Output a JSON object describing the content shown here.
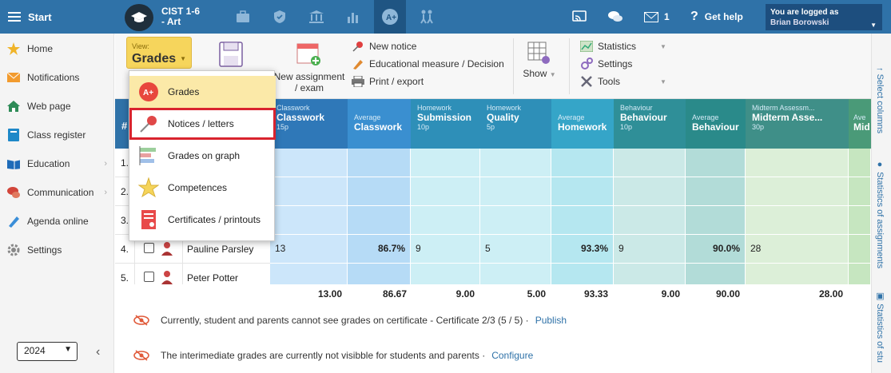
{
  "topbar": {
    "start_label": "Start",
    "class_name": "CIST 1-6",
    "class_sub": "- Art",
    "messages_count": "1",
    "help_label": "Get help",
    "login_caption": "You are logged as",
    "login_user": "Brian Borowski"
  },
  "sidebar": {
    "items": [
      {
        "label": "Home",
        "icon": "star-icon"
      },
      {
        "label": "Notifications",
        "icon": "envelope-icon"
      },
      {
        "label": "Web page",
        "icon": "house-icon"
      },
      {
        "label": "Class register",
        "icon": "book-icon"
      },
      {
        "label": "Education",
        "icon": "open-book-icon"
      },
      {
        "label": "Communication",
        "icon": "chat-icon"
      },
      {
        "label": "Agenda online",
        "icon": "pen-icon"
      },
      {
        "label": "Settings",
        "icon": "gear-icon"
      }
    ],
    "year": "2024"
  },
  "toolbar": {
    "view_caption": "View:",
    "view_value": "Grades",
    "new_assignment": "New assignment / exam",
    "new_notice": "New notice",
    "educational_measure": "Educational measure / Decision",
    "print_export": "Print / export",
    "show": "Show",
    "statistics": "Statistics",
    "settings": "Settings",
    "tools": "Tools"
  },
  "dropdown": {
    "items": [
      "Grades",
      "Notices / letters",
      "Grades on graph",
      "Competences",
      "Certificates / printouts"
    ]
  },
  "grid": {
    "num_header": "#",
    "columns": [
      {
        "t1": "Classwork",
        "t2": "Classwork",
        "t3": "15p"
      },
      {
        "t1": "Average",
        "t2": "Classwork",
        "t3": ""
      },
      {
        "t1": "Homework",
        "t2": "Submission",
        "t3": "10p"
      },
      {
        "t1": "Homework",
        "t2": "Quality",
        "t3": "5p"
      },
      {
        "t1": "Average",
        "t2": "Homework",
        "t3": ""
      },
      {
        "t1": "Behaviour",
        "t2": "Behaviour",
        "t3": "10p"
      },
      {
        "t1": "Average",
        "t2": "Behaviour",
        "t3": ""
      },
      {
        "t1": "Midterm Assessm...",
        "t2": "Midterm Asse...",
        "t3": "30p"
      },
      {
        "t1": "Ave",
        "t2": "Mid",
        "t3": ""
      }
    ],
    "rows": [
      {
        "num": "1.",
        "name": ""
      },
      {
        "num": "2.",
        "name": ""
      },
      {
        "num": "3.",
        "name": ""
      },
      {
        "num": "4.",
        "name": "Pauline Parsley",
        "values": [
          "13",
          "86.7%",
          "9",
          "5",
          "93.3%",
          "9",
          "90.0%",
          "28",
          ""
        ]
      },
      {
        "num": "5.",
        "name": "Peter Potter"
      }
    ],
    "totals": [
      "13.00",
      "86.67",
      "9.00",
      "5.00",
      "93.33",
      "9.00",
      "90.00",
      "28.00"
    ]
  },
  "notes": [
    {
      "text": "Currently, student and parents cannot see grades on certificate - Certificate 2/3 (5 / 5) ·",
      "link": "Publish"
    },
    {
      "text": "The interimediate grades are currently not visibble for students and parents ·",
      "link": "Configure"
    }
  ],
  "right_panel": {
    "tabs": [
      "Select columns",
      "Statistics of assignments",
      "Statistics of stu"
    ]
  }
}
